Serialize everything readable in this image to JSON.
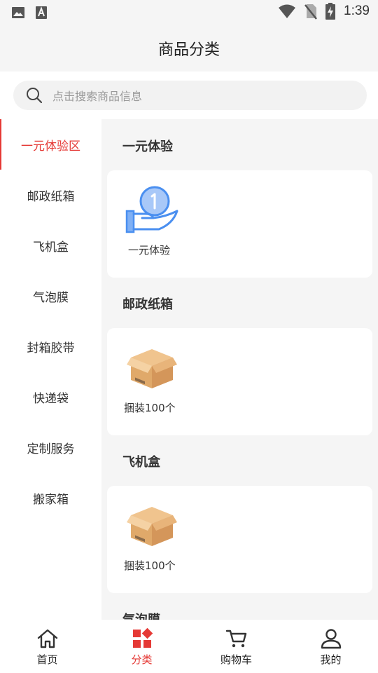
{
  "status_bar": {
    "time": "1:39"
  },
  "header": {
    "title": "商品分类"
  },
  "search": {
    "placeholder": "点击搜索商品信息"
  },
  "sidebar": {
    "items": [
      {
        "label": "一元体验区",
        "active": true
      },
      {
        "label": "邮政纸箱"
      },
      {
        "label": "飞机盒"
      },
      {
        "label": "气泡膜"
      },
      {
        "label": "封箱胶带"
      },
      {
        "label": "快递袋"
      },
      {
        "label": "定制服务"
      },
      {
        "label": "搬家箱"
      }
    ]
  },
  "sections": [
    {
      "title": "一元体验",
      "product_label": "一元体验",
      "icon": "coin-hand-icon"
    },
    {
      "title": "邮政纸箱",
      "product_label": "捆装100个",
      "icon": "cardboard-box-icon"
    },
    {
      "title": "飞机盒",
      "product_label": "捆装100个",
      "icon": "cardboard-box-icon"
    },
    {
      "title": "气泡膜"
    }
  ],
  "tabbar": {
    "items": [
      {
        "label": "首页",
        "icon": "home-icon"
      },
      {
        "label": "分类",
        "icon": "category-icon",
        "active": true
      },
      {
        "label": "购物车",
        "icon": "cart-icon"
      },
      {
        "label": "我的",
        "icon": "user-icon"
      }
    ]
  },
  "colors": {
    "accent": "#e53935",
    "icon_blue": "#4a8ff0",
    "box_tan": "#e8b47a"
  }
}
